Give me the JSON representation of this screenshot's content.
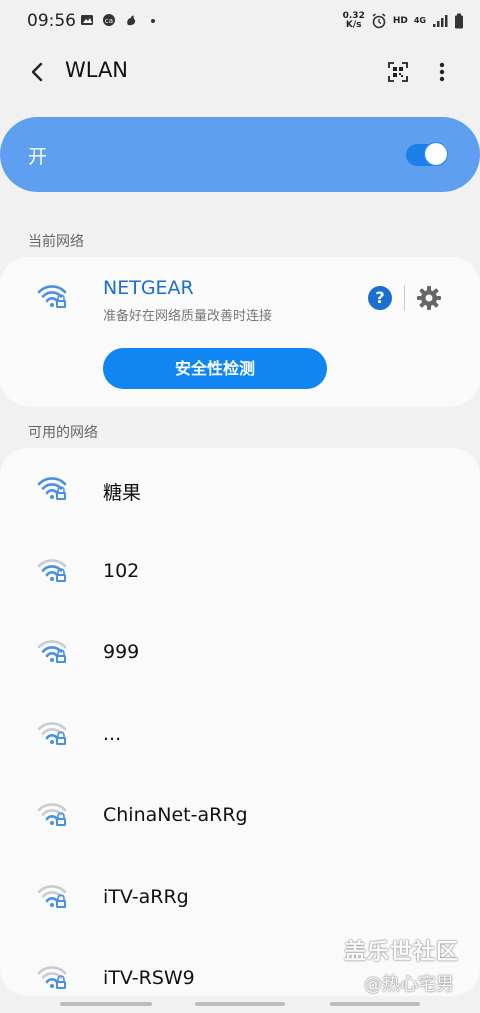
{
  "status_bar": {
    "time": "09:56",
    "net_speed_value": "0.32",
    "net_speed_unit": "K/s",
    "hd_label": "HD",
    "network_type": "4G",
    "icons": [
      "image-icon",
      "cloud-icon",
      "app-icon",
      "dot-icon",
      "alarm-icon",
      "signal-icon",
      "battery-icon"
    ]
  },
  "header": {
    "title": "WLAN",
    "icons": [
      "back-arrow-icon",
      "qr-scan-icon",
      "more-vert-icon"
    ]
  },
  "master_switch": {
    "label": "开",
    "state": "on",
    "accent_color": "#5ea0ef",
    "toggle_color": "#1a7fe8"
  },
  "current_section": {
    "label": "当前网络",
    "network": {
      "ssid": "NETGEAR",
      "status": "准备好在网络质量改善时连接",
      "secured": true,
      "help_label": "?",
      "security_button_label": "安全性检测"
    }
  },
  "available_section": {
    "label": "可用的网络",
    "networks": [
      {
        "ssid": "糖果",
        "signal": "strong",
        "secured": true
      },
      {
        "ssid": "102",
        "signal": "medium",
        "secured": true
      },
      {
        "ssid": "999",
        "signal": "medium",
        "secured": true
      },
      {
        "ssid": "...",
        "signal": "weak",
        "secured": true
      },
      {
        "ssid": "ChinaNet-aRRg",
        "signal": "weak",
        "secured": true
      },
      {
        "ssid": "iTV-aRRg",
        "signal": "weak",
        "secured": true
      },
      {
        "ssid": "iTV-RSW9",
        "signal": "weak",
        "secured": true
      }
    ]
  },
  "watermark": {
    "line1": "盖乐世社区",
    "line2": "@热心宅男"
  }
}
